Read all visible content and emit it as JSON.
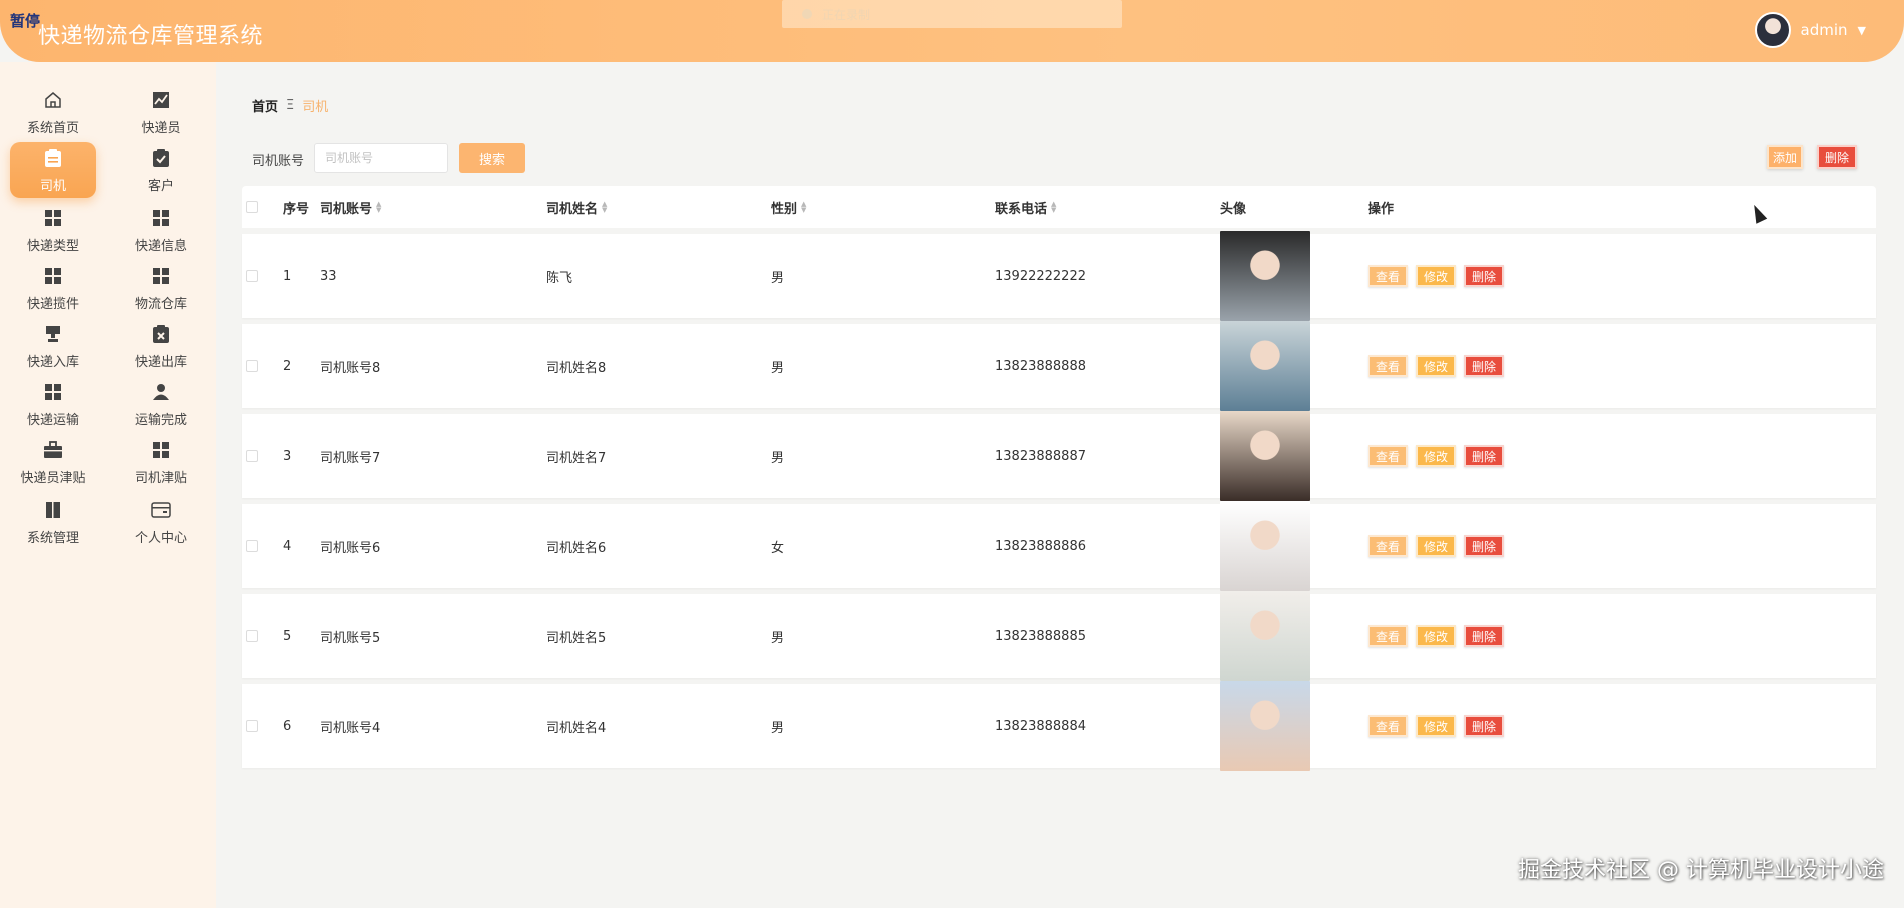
{
  "header": {
    "badge": "暂停",
    "title": "快递物流仓库管理系统",
    "ghost_text": "正在录制",
    "username": "admin"
  },
  "sidebar": {
    "items": [
      {
        "label": "系统首页",
        "icon": "home-icon"
      },
      {
        "label": "快递员",
        "icon": "chart-icon"
      },
      {
        "label": "司机",
        "icon": "clipboard-icon",
        "active": true
      },
      {
        "label": "客户",
        "icon": "clipboard-check-icon"
      },
      {
        "label": "快递类型",
        "icon": "grid-icon"
      },
      {
        "label": "快递信息",
        "icon": "grid-icon"
      },
      {
        "label": "快递揽件",
        "icon": "grid-icon"
      },
      {
        "label": "物流仓库",
        "icon": "grid-icon"
      },
      {
        "label": "快递入库",
        "icon": "stamp-icon"
      },
      {
        "label": "快递出库",
        "icon": "clipboard-x-icon"
      },
      {
        "label": "快递运输",
        "icon": "grid-icon"
      },
      {
        "label": "运输完成",
        "icon": "user-icon"
      },
      {
        "label": "快递员津贴",
        "icon": "briefcase-icon"
      },
      {
        "label": "司机津贴",
        "icon": "grid-icon"
      },
      {
        "label": "系统管理",
        "icon": "book-icon"
      },
      {
        "label": "个人中心",
        "icon": "wallet-icon"
      }
    ]
  },
  "breadcrumb": {
    "home": "首页",
    "separator": "Ξ",
    "current": "司机"
  },
  "search": {
    "label": "司机账号",
    "placeholder": "司机账号",
    "button": "搜索"
  },
  "toolbar": {
    "add_label": "添加",
    "delete_label": "删除"
  },
  "table": {
    "columns": {
      "index": "序号",
      "account": "司机账号",
      "name": "司机姓名",
      "gender": "性别",
      "phone": "联系电话",
      "avatar": "头像",
      "actions": "操作"
    },
    "action_labels": {
      "view": "查看",
      "edit": "修改",
      "delete": "删除"
    },
    "rows": [
      {
        "index": "1",
        "account": "33",
        "name": "陈飞",
        "gender": "男",
        "phone": "13922222222",
        "photo_colors": [
          "#9aa3ab",
          "#2a2a2a"
        ]
      },
      {
        "index": "2",
        "account": "司机账号8",
        "name": "司机姓名8",
        "gender": "男",
        "phone": "13823888888",
        "photo_colors": [
          "#5d7f95",
          "#c9d4d8"
        ]
      },
      {
        "index": "3",
        "account": "司机账号7",
        "name": "司机姓名7",
        "gender": "男",
        "phone": "13823888887",
        "photo_colors": [
          "#3a2d28",
          "#e8d8c8"
        ]
      },
      {
        "index": "4",
        "account": "司机账号6",
        "name": "司机姓名6",
        "gender": "女",
        "phone": "13823888886",
        "photo_colors": [
          "#d9d4d2",
          "#ffffff"
        ]
      },
      {
        "index": "5",
        "account": "司机账号5",
        "name": "司机姓名5",
        "gender": "男",
        "phone": "13823888885",
        "photo_colors": [
          "#cfd6d0",
          "#f1eeea"
        ]
      },
      {
        "index": "6",
        "account": "司机账号4",
        "name": "司机姓名4",
        "gender": "男",
        "phone": "13823888884",
        "photo_colors": [
          "#e9c9b3",
          "#c8d8e9"
        ]
      }
    ]
  },
  "watermark": "掘金技术社区 @ 计算机毕业设计小途",
  "colors": {
    "accent": "#fcb570",
    "danger": "#e84d3d",
    "sidebar_bg": "#fdf3e9"
  }
}
